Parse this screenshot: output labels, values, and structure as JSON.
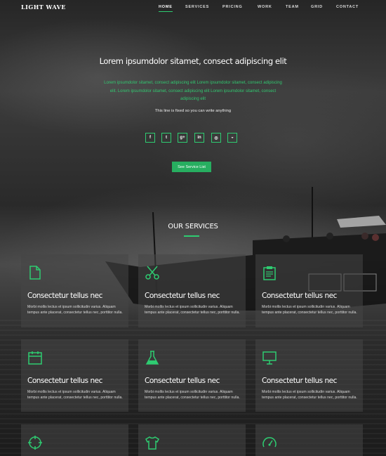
{
  "brand": "LIGHT WAVE",
  "nav": [
    "HOME",
    "SERVICES",
    "PRICING",
    "WORK",
    "TEAM",
    "GRID",
    "CONTACT"
  ],
  "nav_active": "HOME",
  "hero": {
    "title": "Lorem ipsumdolor sitamet, consect adipiscing elit",
    "lead": "Lorem ipsumdolor sitamet, consect adipiscing elit Lorem ipsumdolor sitamet, consect adipiscing elit. Lorem ipsumdolor sitamet, consect adipiscing elit Lorem ipsumdolor sitamet, consect adipiscing elit",
    "fixed_line": "This line is fixed so you can write anything"
  },
  "socials": [
    {
      "icon": "facebook-icon",
      "glyph": "f"
    },
    {
      "icon": "twitter-icon",
      "glyph": "t"
    },
    {
      "icon": "google-plus-icon",
      "glyph": "g+"
    },
    {
      "icon": "linkedin-icon",
      "glyph": "in"
    },
    {
      "icon": "dribbble-icon",
      "glyph": "◎"
    },
    {
      "icon": "github-icon",
      "glyph": "◒"
    }
  ],
  "cta": "See Service List",
  "services_title": "OUR SERVICES",
  "services": [
    {
      "icon": "document-icon",
      "title": "Consectetur tellus nec",
      "text": "Morbi mollis lectus et ipsum sollicitudin varius. Aliquam tempus ante placerat, consectetur tellus nec, porttitor nulla."
    },
    {
      "icon": "scissors-icon",
      "title": "Consectetur tellus nec",
      "text": "Morbi mollis lectus et ipsum sollicitudin varius. Aliquam tempus ante placerat, consectetur tellus nec, porttitor nulla."
    },
    {
      "icon": "clipboard-icon",
      "title": "Consectetur tellus nec",
      "text": "Morbi mollis lectus et ipsum sollicitudin varius. Aliquam tempus ante placerat, consectetur tellus nec, porttitor nulla."
    },
    {
      "icon": "calendar-icon",
      "title": "Consectetur tellus nec",
      "text": "Morbi mollis lectus et ipsum sollicitudin varius. Aliquam tempus ante placerat, consectetur tellus nec, porttitor nulla."
    },
    {
      "icon": "flask-icon",
      "title": "Consectetur tellus nec",
      "text": "Morbi mollis lectus et ipsum sollicitudin varius. Aliquam tempus ante placerat, consectetur tellus nec, porttitor nulla."
    },
    {
      "icon": "monitor-icon",
      "title": "Consectetur tellus nec",
      "text": "Morbi mollis lectus et ipsum sollicitudin varius. Aliquam tempus ante placerat, consectetur tellus nec, porttitor nulla."
    },
    {
      "icon": "crosshair-icon",
      "title": "",
      "text": ""
    },
    {
      "icon": "tshirt-icon",
      "title": "",
      "text": ""
    },
    {
      "icon": "speedometer-icon",
      "title": "",
      "text": ""
    }
  ],
  "colors": {
    "accent": "#2ecc71",
    "button": "#27ae60",
    "card": "#464646"
  }
}
